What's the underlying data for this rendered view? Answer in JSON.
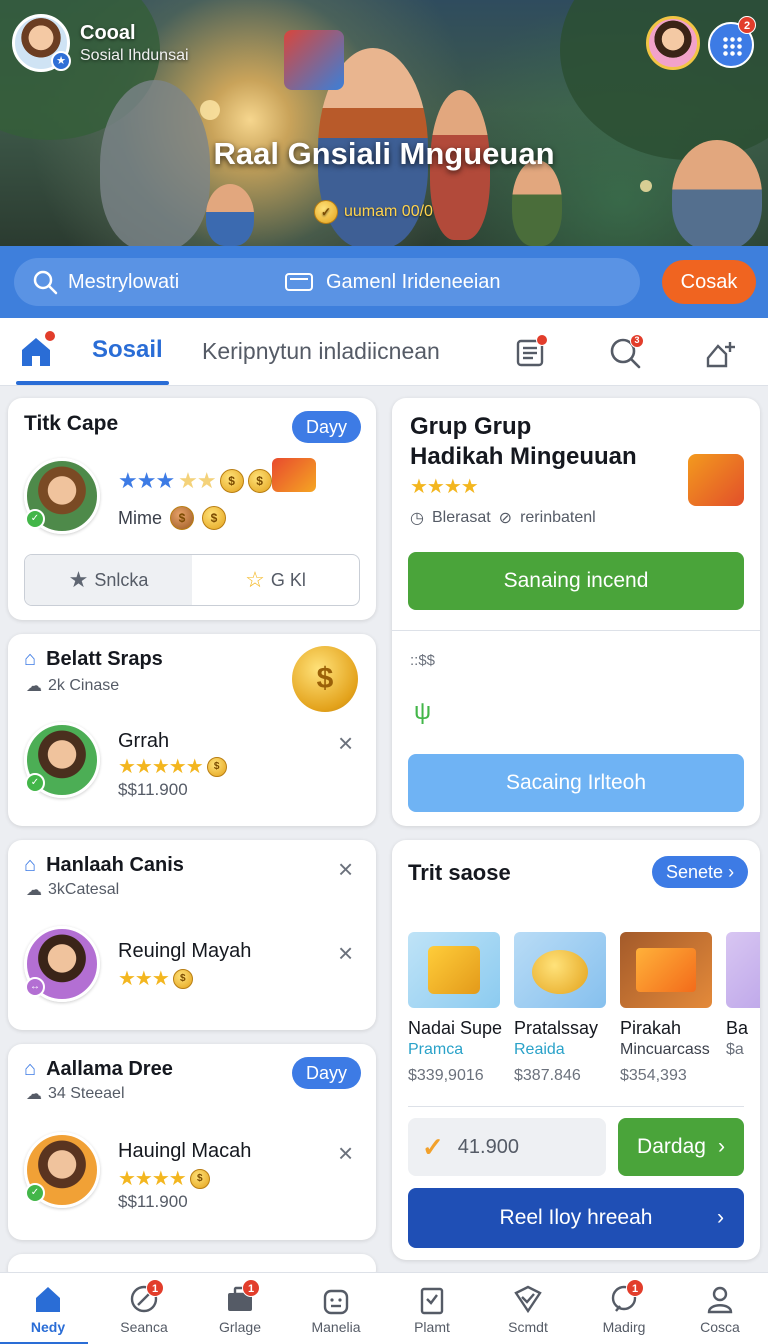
{
  "hero": {
    "profile_name": "Cooal",
    "profile_sub": "Sosial Ihdunsai",
    "title": "Raal Gnsiali Mngueuan",
    "badge_text": "uumam 00/0",
    "grid_badge": "2"
  },
  "search": {
    "field1": "Mestrylowati",
    "field2": "Gamenl Irideneeian",
    "button": "Cosak"
  },
  "tabs": {
    "active": "Sosail",
    "other": "Keripnytun inladiicnean",
    "home_badge": "",
    "list_badge": "",
    "search_badge": "3"
  },
  "card1": {
    "title": "Titk Cape",
    "pill": "Dayy",
    "mime": "Mime",
    "seg_a": "Snlcka",
    "seg_b": "G Kl"
  },
  "card2": {
    "title": "Belatt Sraps",
    "meta": "2k Cinase",
    "name": "Grrah",
    "price": "$$11.900"
  },
  "card3": {
    "title": "Hanlaah Canis",
    "meta": "3kCatesal",
    "name": "Reuingl Mayah"
  },
  "card4": {
    "title": "Aallama Dree",
    "pill": "Dayy",
    "meta": "34 Steeael",
    "name": "Hauingl Macah",
    "price": "$$11.900"
  },
  "group": {
    "title_line1": "Grup Grup",
    "title_line2": "Hadikah Mingeuuan",
    "meta1": "Blerasat",
    "meta2": "rerinbatenl",
    "btn_green": "Sanaing incend",
    "small_text": "::$$",
    "btn_light": "Sacaing Irlteoh"
  },
  "shop": {
    "title": "Trit saose",
    "pill": "Senete",
    "products": [
      {
        "name": "Nadai Supe",
        "sub": "Pramca",
        "price": "$339,9016"
      },
      {
        "name": "Pratalssay",
        "sub": "Reaida",
        "price": "$387.846"
      },
      {
        "name": "Pirakah",
        "sub": "Mincuarcass",
        "price": "$354,393"
      },
      {
        "name": "Ba",
        "sub": "$a",
        "price": ""
      }
    ],
    "amount": "41.900",
    "btn_dardag": "Dardag",
    "btn_blue": "Reel Iloy hreeah"
  },
  "nav": [
    {
      "label": "Nedy",
      "badge": ""
    },
    {
      "label": "Seanca",
      "badge": "1"
    },
    {
      "label": "Grlage",
      "badge": "1"
    },
    {
      "label": "Manelia",
      "badge": ""
    },
    {
      "label": "Plamt",
      "badge": ""
    },
    {
      "label": "Scmdt",
      "badge": ""
    },
    {
      "label": "Madirg",
      "badge": "1"
    },
    {
      "label": "Cosca",
      "badge": ""
    }
  ],
  "colors": {
    "primary": "#2a6dd6",
    "search_bar": "#3e7fdc",
    "search_button": "#f06420",
    "green_button": "#4aa43a",
    "light_button": "#6fb3f4",
    "navy_button": "#1f4fb5"
  }
}
